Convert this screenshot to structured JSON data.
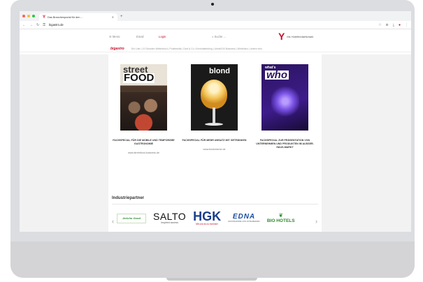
{
  "browser": {
    "tab_title": "Das Branchenportal für den ...",
    "url": "bigastro.de",
    "new_tab": "+"
  },
  "site": {
    "menu": "Menü",
    "email": "Email",
    "login": "Login",
    "search": "Suche ...",
    "brand_mark": "Y",
    "brand_text": "Ms Hotelbedarfsmark",
    "subnav_logo": "bigastro",
    "subnav_items": "Ein Liter | 10 Stunden Weltrekord | Podekristik | Dart & Co | Kernhaltefoling | Urbail100 Business | Wettchino | where who"
  },
  "cards": [
    {
      "title_a": "street",
      "title_b": "FOOD",
      "desc": "FACHSPECIAL FÜR DIE MOBILE UND TEMPORÄRE GASTRONOMIE",
      "link": "www.streetfood-business.de"
    },
    {
      "title_a": "blond",
      "desc": "FACHSPECIAL FÜR MEHR UMSATZ MIT GETRÄNKEN",
      "link": "www.bookmicme.de"
    },
    {
      "title_a": "what's",
      "title_b": "who",
      "desc": "FACHSPECIAL ZUR PRÄSENTATION VON UNTERNEHMEN UND PRODUKTEN IM AUSSER-HAUS-MARKT",
      "link": ""
    }
  ],
  "partners": {
    "title": "Industriepartner",
    "prev": "‹",
    "next": "›",
    "stihl": "Jericho Good",
    "salto_main": "SALTO",
    "salto_sub": "inspired access",
    "hgk_main": "HGK",
    "hgk_sub": "Mit uns ist zu rechnen!",
    "edna_main": "EDNA",
    "edna_sub": "GROSSHANDEL FÜR HOTELBEDARF",
    "bio_main": "BIO HOTELS"
  },
  "colors": {
    "accent": "#c3102c",
    "monitor": "#dcdde0"
  },
  "icons": [
    "back-icon",
    "forward-icon",
    "reload-icon",
    "lock-icon",
    "star-icon",
    "download-icon",
    "menu-dots-icon"
  ]
}
